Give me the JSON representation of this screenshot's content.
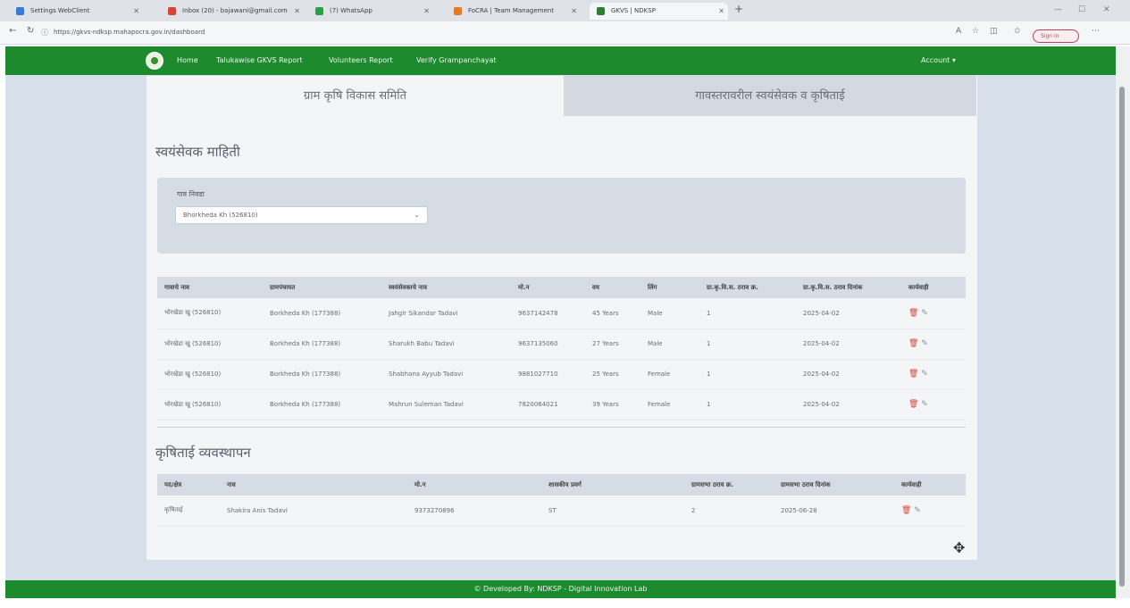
{
  "browser": {
    "tabs": [
      {
        "label": "Settings WebClient",
        "color": "#3a78d8"
      },
      {
        "label": "Inbox (20) - bajawani@gmail.com",
        "color": "#d44638"
      },
      {
        "label": "(7) WhatsApp",
        "color": "#25a244"
      },
      {
        "label": "FoCRA | Team Management",
        "color": "#e07b28"
      },
      {
        "label": "GKVS | NDKSP",
        "color": "#2e7d32"
      }
    ],
    "new_tab": "+",
    "url": "https://gkvs-ndksp.mahapocra.gov.in/dashboard",
    "sign_in": "Sign in"
  },
  "nav": {
    "links": [
      "Home",
      "Talukawise GKVS Report",
      "Volunteers Report",
      "Verify Grampanchayat"
    ],
    "account": "Account ▾"
  },
  "tabs": {
    "tab1": "ग्राम कृषि विकास समिति",
    "tab2": "गावस्तरावरील स्वयंसेवक व कृषिताई"
  },
  "volunteer_section": {
    "title": "स्वयंसेवक माहिती",
    "filter_label": "गाव निवडा",
    "filter_value": "Bhorkheda Kh (526810)",
    "headers": [
      "गावाचे नाव",
      "ग्रामपंचायत",
      "स्वयंसेवकाचे नाव",
      "मो.न",
      "वय",
      "लिंग",
      "ग्रा.कृ.वि.स. ठराव क्र.",
      "ग्रा.कृ.वि.स. ठराव दिनांक",
      "कार्यवाही"
    ],
    "rows": [
      [
        "भोरखेडा खु (526810)",
        "Borkheda Kh (177388)",
        "Jahgir Sikandar Tadavi",
        "9637142478",
        "45 Years",
        "Male",
        "1",
        "2025-04-02"
      ],
      [
        "भोरखेडा खु (526810)",
        "Borkheda Kh (177388)",
        "Sharukh Babu Tadavi",
        "9637135060",
        "27 Years",
        "Male",
        "1",
        "2025-04-02"
      ],
      [
        "भोरखेडा खु (526810)",
        "Borkheda Kh (177388)",
        "Shabhana Ayyub Tadavi",
        "9881027710",
        "25 Years",
        "Female",
        "1",
        "2025-04-02"
      ],
      [
        "भोरखेडा खु (526810)",
        "Borkheda Kh (177388)",
        "Mahrun Suleman Tadavi",
        "7820064021",
        "39 Years",
        "Female",
        "1",
        "2025-04-02"
      ]
    ]
  },
  "krushitai_section": {
    "title": "कृषिताई व्यवस्थापन",
    "headers": [
      "पद/क्षेत्र",
      "नाव",
      "मो.न",
      "शासकीय प्रवर्ग",
      "ग्रामसभा ठराव क्र.",
      "ग्रामसभा ठराव दिनांक",
      "कार्यवाही"
    ],
    "rows": [
      [
        "कृषिताई",
        "Shakira Anis Tadavi",
        "9373270896",
        "ST",
        "2",
        "2025-06-28"
      ]
    ]
  },
  "actions": {
    "delete_icon": "🗑",
    "edit_icon": "✎"
  },
  "footer": "© Developed By: NDKSP - Digital Innovation Lab"
}
